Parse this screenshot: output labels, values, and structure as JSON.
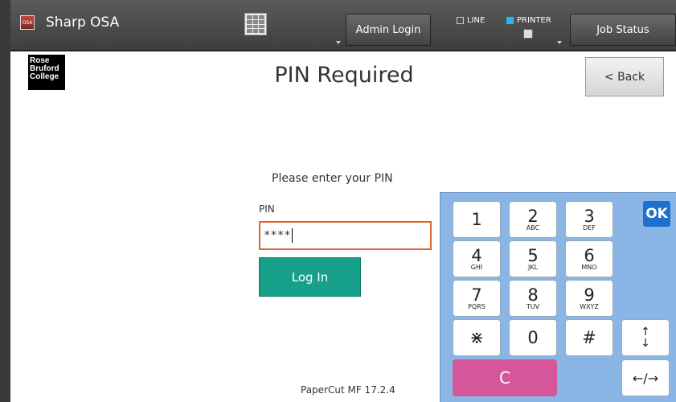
{
  "topbar": {
    "app_title": "Sharp OSA",
    "brand_icon_text": "OSA",
    "admin_login": "Admin Login",
    "line_label": "LINE",
    "printer_label": "PRINTER",
    "job_status": "Job Status",
    "printer_color": "#29b6e8"
  },
  "page": {
    "logo_lines": [
      "Rose",
      "Bruford",
      "College"
    ],
    "title": "PIN Required",
    "back_label": "< Back",
    "prompt": "Please enter your PIN",
    "pin_label": "PIN",
    "pin_value": "****",
    "login_label": "Log In",
    "footer": "PaperCut MF 17.2.4"
  },
  "numpad": {
    "ok_label": "OK",
    "keys": [
      {
        "digit": "1",
        "letters": ""
      },
      {
        "digit": "2",
        "letters": "ABC"
      },
      {
        "digit": "3",
        "letters": "DEF"
      },
      {
        "digit": "4",
        "letters": "GHI"
      },
      {
        "digit": "5",
        "letters": "JKL"
      },
      {
        "digit": "6",
        "letters": "MNO"
      },
      {
        "digit": "7",
        "letters": "PQRS"
      },
      {
        "digit": "8",
        "letters": "TUV"
      },
      {
        "digit": "9",
        "letters": "WXYZ"
      },
      {
        "digit": "⋇",
        "letters": ""
      },
      {
        "digit": "0",
        "letters": ""
      },
      {
        "digit": "#",
        "letters": ""
      }
    ],
    "clear_label": "C",
    "updown_label": "↑\n↓",
    "leftright_label": "←/→",
    "colors": {
      "pad": "#8ab6e6",
      "ok": "#1f6fcf",
      "clear": "#d6569b",
      "login": "#16a08a",
      "focus": "#e4632a"
    }
  }
}
